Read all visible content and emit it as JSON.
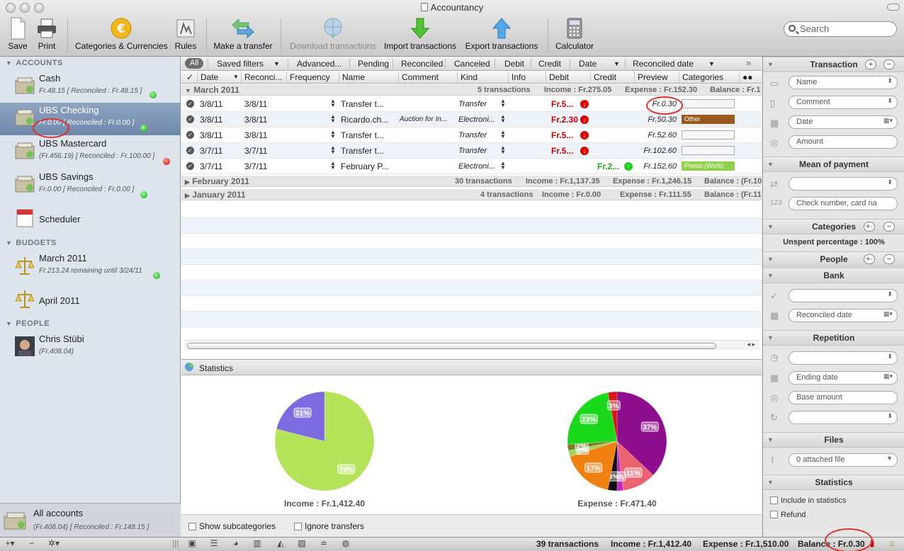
{
  "window": {
    "title": "Accountancy"
  },
  "toolbar": {
    "save": "Save",
    "print": "Print",
    "categories": "Categories & Currencies",
    "rules": "Rules",
    "transfer": "Make a transfer",
    "download": "Download transactions",
    "import": "Import transactions",
    "export": "Export transactions",
    "calculator": "Calculator",
    "search_placeholder": "Search"
  },
  "sidebar": {
    "accounts_header": "ACCOUNTS",
    "accounts": [
      {
        "name": "Cash",
        "sub": "Fr.48.15 [ Reconciled : Fr.48.15 ]",
        "status": "green"
      },
      {
        "name": "UBS Checking",
        "sub": "Fr.0.00 [ Reconciled : Fr.0.00 ]",
        "status": "green"
      },
      {
        "name": "UBS Mastercard",
        "sub": "(Fr.456.19) [ Reconciled : Fr.100.00 ]",
        "status": "red"
      },
      {
        "name": "UBS Savings",
        "sub": "Fr.0.00 [ Reconciled : Fr.0.00 ]",
        "status": "green"
      },
      {
        "name": "Scheduler",
        "sub": ""
      }
    ],
    "budgets_header": "BUDGETS",
    "budgets": [
      {
        "name": "March 2011",
        "sub": "Fr.213.24 remaining until 3/24/11"
      },
      {
        "name": "April 2011",
        "sub": ""
      }
    ],
    "people_header": "PEOPLE",
    "people": [
      {
        "name": "Chris Stübi",
        "sub": "(Fr.408.04)"
      }
    ],
    "all_accounts": {
      "name": "All accounts",
      "sub": "(Fr.408.04) [ Reconciled : Fr.148.15 ]"
    }
  },
  "filters": {
    "all": "All",
    "saved": "Saved filters",
    "advanced": "Advanced...",
    "pending": "Pending",
    "reconciled": "Reconciled",
    "canceled": "Canceled",
    "debit": "Debit",
    "credit": "Credit",
    "date": "Date",
    "reconciled_date": "Reconciled date"
  },
  "columns": {
    "check": "✓",
    "date": "Date",
    "reconciled": "Reconci...",
    "frequency": "Frequency",
    "name": "Name",
    "comment": "Comment",
    "kind": "Kind",
    "info": "Info",
    "debit": "Debit",
    "credit": "Credit",
    "preview": "Preview",
    "categories": "Categories"
  },
  "groups": {
    "march": {
      "label": "March 2011",
      "count": "5 transactions",
      "income": "Income : Fr.275.05",
      "expense": "Expense : Fr.152.30",
      "balance": "Balance : Fr.1"
    },
    "february": {
      "label": "February 2011",
      "count": "30 transactions",
      "income": "Income : Fr.1,137.35",
      "expense": "Expense : Fr.1,246.15",
      "balance": "Balance : (Fr.10"
    },
    "january": {
      "label": "January 2011",
      "count": "4 transactions",
      "income": "Income : Fr.0.00",
      "expense": "Expense : Fr.111.55",
      "balance": "Balance : (Fr.11"
    }
  },
  "rows": [
    {
      "date": "3/8/11",
      "rec": "3/8/11",
      "name": "Transfer t...",
      "comment": "",
      "kind": "Transfer",
      "debit": "Fr.5...",
      "credit": "",
      "preview": "Fr.0.30",
      "category": "",
      "catcolor": ""
    },
    {
      "date": "3/8/11",
      "rec": "3/8/11",
      "name": "Ricardo.ch...",
      "comment": "Auction for In...",
      "kind": "Electroni...",
      "debit": "Fr.2.30",
      "credit": "",
      "preview": "Fr.50.30",
      "category": "Other",
      "catcolor": "#9a5a1e"
    },
    {
      "date": "3/8/11",
      "rec": "3/8/11",
      "name": "Transfer t...",
      "comment": "",
      "kind": "Transfer",
      "debit": "Fr.5...",
      "credit": "",
      "preview": "Fr.52.60",
      "category": "",
      "catcolor": ""
    },
    {
      "date": "3/7/11",
      "rec": "3/7/11",
      "name": "Transfer t...",
      "comment": "",
      "kind": "Transfer",
      "debit": "Fr.5...",
      "credit": "",
      "preview": "Fr.102.60",
      "category": "",
      "catcolor": ""
    },
    {
      "date": "3/7/11",
      "rec": "3/7/11",
      "name": "February P...",
      "comment": "",
      "kind": "Electroni...",
      "debit": "",
      "credit": "Fr.2...",
      "preview": "Fr.152.60",
      "category": "Presto (Work)",
      "catcolor": "#8fd24a"
    }
  ],
  "statistics": {
    "title": "Statistics",
    "income_label": "Income : Fr.1,412.40",
    "expense_label": "Expense : Fr.471.40",
    "income_slices": [
      {
        "label": "79%",
        "value": 79,
        "color": "#b5e35a"
      },
      {
        "label": "21%",
        "value": 21,
        "color": "#7d6be0"
      }
    ],
    "expense_slices": [
      {
        "label": "37%",
        "value": 37,
        "color": "#8e0e8e"
      },
      {
        "label": "11%",
        "value": 11,
        "color": "#ea6470"
      },
      {
        "label": "2%",
        "value": 2,
        "color": "#c028c0"
      },
      {
        "label": "3%",
        "value": 3,
        "color": "#111111"
      },
      {
        "label": "17%",
        "value": 17,
        "color": "#f08010"
      },
      {
        "label": "2%",
        "value": 2,
        "color": "#a3d060"
      },
      {
        "label": "2%",
        "value": 2,
        "color": "#7a7a20"
      },
      {
        "label": "23%",
        "value": 23,
        "color": "#1ad81a"
      },
      {
        "label": "3%",
        "value": 3,
        "color": "#d81818"
      }
    ],
    "show_subcategories": "Show subcategories",
    "ignore_transfers": "Ignore transfers"
  },
  "inspector": {
    "transaction": "Transaction",
    "name": "Name",
    "comment": "Comment",
    "date": "Date",
    "amount": "Amount",
    "mean_of_payment": "Mean of payment",
    "check_number": "Check number, card na",
    "categories": "Categories",
    "unspent": "Unspent percentage : 100%",
    "people": "People",
    "bank": "Bank",
    "reconciled_date": "Reconciled date",
    "repetition": "Repetition",
    "ending_date": "Ending date",
    "base_amount": "Base amount",
    "files": "Files",
    "attached": "0 attached file",
    "statistics": "Statistics",
    "include": "Include in statistics",
    "refund": "Refund"
  },
  "status": {
    "count": "39 transactions",
    "income": "Income : Fr.1,412.40",
    "expense": "Expense : Fr.1,510.00",
    "balance": "Balance : Fr.0.30"
  },
  "colors": {
    "debit": "#d60000",
    "credit": "#19b019",
    "selection": "#7a93b6"
  }
}
